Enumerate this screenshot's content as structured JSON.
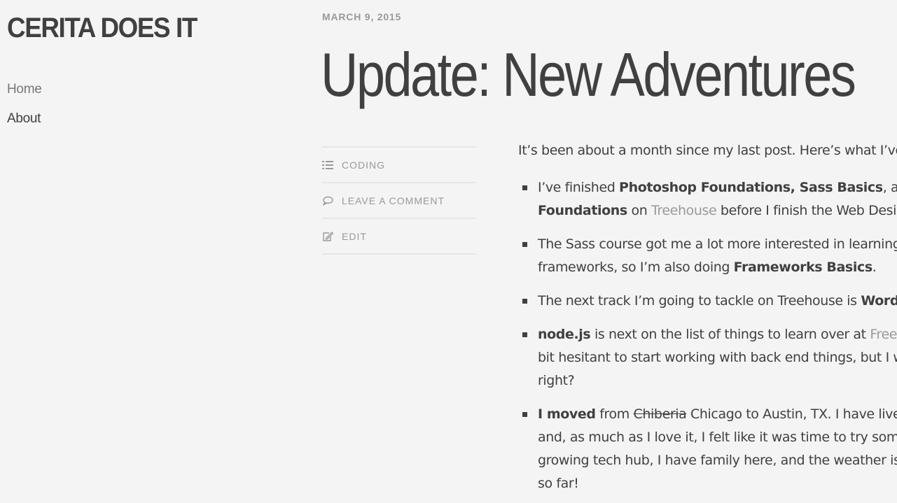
{
  "site": {
    "title": "CERITA DOES IT"
  },
  "nav": {
    "home": "Home",
    "about": "About"
  },
  "post": {
    "date": "MARCH 9, 2015",
    "title": "Update: New Adventures",
    "meta": {
      "category": "CODING",
      "comment": "LEAVE A COMMENT",
      "edit": "EDIT",
      "category_icon": "list-icon",
      "comment_icon": "speech-bubble-icon",
      "edit_icon": "edit-icon"
    },
    "intro": "It’s been about a month since my last post. Here’s what I’ve",
    "items": {
      "i1": {
        "t1": "I’ve finished ",
        "b1": "Photoshop Foundations, Sass Basics",
        "t2": ", and",
        "b2": "Foundations",
        "t3": " on ",
        "link": "Treehouse",
        "t4": " before I finish the Web Desig"
      },
      "i2": {
        "t1": "The Sass course got me a lot more interested in learning",
        "t2": "frameworks, so I’m also doing ",
        "b1": "Frameworks Basics",
        "t3": "."
      },
      "i3": {
        "t1": "The next track I’m going to tackle on Treehouse is ",
        "b1": "WordP"
      },
      "i4": {
        "b1": "node.js",
        "t1": " is next on the list of things to learn over at ",
        "link": "FreeC",
        "t2": "bit hesitant to start working with back end things, but I w",
        "t3": "right?"
      },
      "i5": {
        "b1": " I moved",
        "t1": " from ",
        "s1": "Chiberia",
        "t2": " Chicago to Austin, TX.  I have live",
        "t3": "and, as much as I love it, I felt like it was time to try some",
        "t4": "growing tech hub, I have family here, and the weather is",
        "t5": "so far!"
      }
    }
  }
}
